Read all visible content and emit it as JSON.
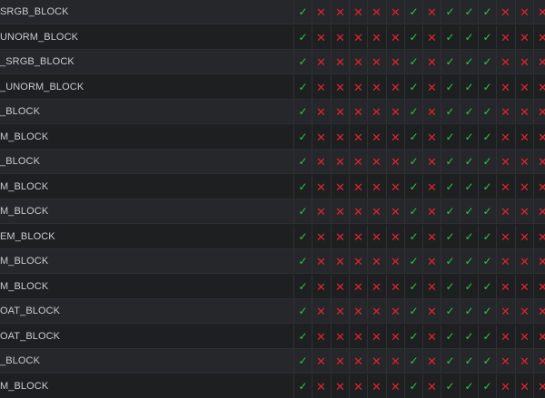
{
  "colors": {
    "background": "#1e1f21",
    "row_alt": "#25272a",
    "check": "#35c24a",
    "cross": "#e0242e",
    "text": "#c8cbd0"
  },
  "icons": {
    "yes": "checkmark-icon",
    "no": "cross-icon"
  },
  "glyphs": {
    "yes": "✓",
    "no": "✕"
  },
  "rows": [
    {
      "label": "SRGB_BLOCK",
      "support": [
        1,
        0,
        0,
        0,
        0,
        0,
        1,
        0,
        1,
        1,
        1,
        0,
        0,
        0
      ]
    },
    {
      "label": "UNORM_BLOCK",
      "support": [
        1,
        0,
        0,
        0,
        0,
        0,
        1,
        0,
        1,
        1,
        1,
        0,
        0,
        0
      ]
    },
    {
      "label": "_SRGB_BLOCK",
      "support": [
        1,
        0,
        0,
        0,
        0,
        0,
        1,
        0,
        1,
        1,
        1,
        0,
        0,
        0
      ]
    },
    {
      "label": "_UNORM_BLOCK",
      "support": [
        1,
        0,
        0,
        0,
        0,
        0,
        1,
        0,
        1,
        1,
        1,
        0,
        0,
        0
      ]
    },
    {
      "label": "_BLOCK",
      "support": [
        1,
        0,
        0,
        0,
        0,
        0,
        1,
        0,
        1,
        1,
        1,
        0,
        0,
        0
      ]
    },
    {
      "label": "M_BLOCK",
      "support": [
        1,
        0,
        0,
        0,
        0,
        0,
        1,
        0,
        1,
        1,
        1,
        0,
        0,
        0
      ]
    },
    {
      "label": "_BLOCK",
      "support": [
        1,
        0,
        0,
        0,
        0,
        0,
        1,
        0,
        1,
        1,
        1,
        0,
        0,
        0
      ]
    },
    {
      "label": "M_BLOCK",
      "support": [
        1,
        0,
        0,
        0,
        0,
        0,
        1,
        0,
        1,
        1,
        1,
        0,
        0,
        0
      ]
    },
    {
      "label": "M_BLOCK",
      "support": [
        1,
        0,
        0,
        0,
        0,
        0,
        1,
        0,
        1,
        1,
        1,
        0,
        0,
        0
      ]
    },
    {
      "label": "EM_BLOCK",
      "support": [
        1,
        0,
        0,
        0,
        0,
        0,
        1,
        0,
        1,
        1,
        1,
        0,
        0,
        0
      ]
    },
    {
      "label": "M_BLOCK",
      "support": [
        1,
        0,
        0,
        0,
        0,
        0,
        1,
        0,
        1,
        1,
        1,
        0,
        0,
        0
      ]
    },
    {
      "label": "M_BLOCK",
      "support": [
        1,
        0,
        0,
        0,
        0,
        0,
        1,
        0,
        1,
        1,
        1,
        0,
        0,
        0
      ]
    },
    {
      "label": "OAT_BLOCK",
      "support": [
        1,
        0,
        0,
        0,
        0,
        0,
        1,
        0,
        1,
        1,
        1,
        0,
        0,
        0
      ]
    },
    {
      "label": "OAT_BLOCK",
      "support": [
        1,
        0,
        0,
        0,
        0,
        0,
        1,
        0,
        1,
        1,
        1,
        0,
        0,
        0
      ]
    },
    {
      "label": "_BLOCK",
      "support": [
        1,
        0,
        0,
        0,
        0,
        0,
        1,
        0,
        1,
        1,
        1,
        0,
        0,
        0
      ]
    },
    {
      "label": "M_BLOCK",
      "support": [
        1,
        0,
        0,
        0,
        0,
        0,
        1,
        0,
        1,
        1,
        1,
        0,
        0,
        0
      ]
    }
  ]
}
